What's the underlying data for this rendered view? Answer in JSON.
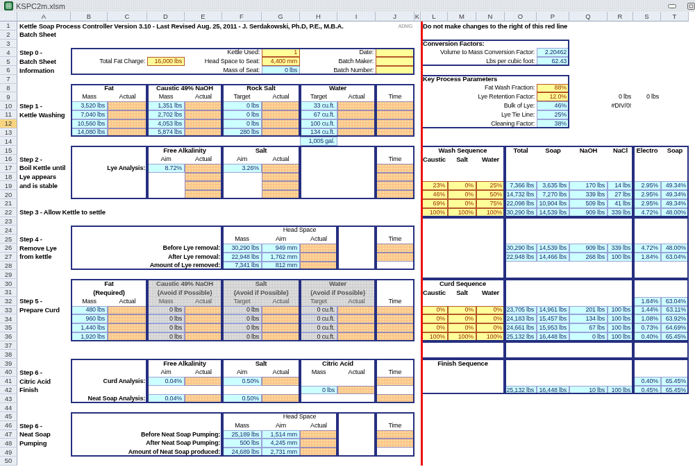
{
  "window": {
    "title": "KSPC2m.xlsm"
  },
  "columns": [
    "A",
    "B",
    "C",
    "D",
    "E",
    "F",
    "G",
    "H",
    "I",
    "J",
    "K",
    "L",
    "M",
    "N",
    "O",
    "P",
    "Q",
    "R",
    "S",
    "T"
  ],
  "rows": [
    {
      "number": "1",
      "selected": false,
      "cells": [
        {
          "kind": "title",
          "text": "Kettle Soap Process Controller Version 3.10 - Last Revised Aug. 25, 2011 - J. Serdakowski, Ph.D, P.E., M.B.A."
        },
        {
          "kind": "note",
          "text": "ADMG"
        },
        {
          "kind": "title",
          "text": "Do not make changes to the right of this red line"
        }
      ]
    },
    {
      "number": "2",
      "selected": false,
      "cells": [
        {
          "kind": "title",
          "text": "Batch Sheet"
        }
      ]
    },
    {
      "number": "3",
      "selected": false,
      "cells": [
        {
          "kind": "title",
          "text": "Conversion Factors:"
        }
      ]
    },
    {
      "number": "4",
      "selected": false,
      "cells": [
        {
          "kind": "step",
          "text": "Step 0 -"
        },
        {
          "kind": "label",
          "text": "Kettle Used:"
        },
        {
          "kind": "param",
          "text": "1"
        },
        {
          "kind": "label",
          "text": "Date:"
        },
        {
          "kind": "param"
        },
        {
          "kind": "label",
          "text": "Volume to Mass Conversion Factor:"
        },
        {
          "kind": "calc",
          "text": "2.20462"
        }
      ]
    },
    {
      "number": "5",
      "selected": false,
      "cells": [
        {
          "kind": "step",
          "text": "Batch Sheet"
        },
        {
          "kind": "label",
          "text": "Total Fat Charge:"
        },
        {
          "kind": "param",
          "text": "16,000 lbs"
        },
        {
          "kind": "label",
          "text": "Head Space to Seat:"
        },
        {
          "kind": "param",
          "text": "4,400 mm"
        },
        {
          "kind": "label",
          "text": "Batch Maker:"
        },
        {
          "kind": "param"
        },
        {
          "kind": "label",
          "text": "Lbs per cubic foot:"
        },
        {
          "kind": "calc",
          "text": "62.43"
        }
      ]
    },
    {
      "number": "6",
      "selected": false,
      "cells": [
        {
          "kind": "step",
          "text": "Information"
        },
        {
          "kind": "label",
          "text": "Mass of Seat:"
        },
        {
          "kind": "calc",
          "text": "0 lbs"
        },
        {
          "kind": "label",
          "text": "Batch Number:"
        },
        {
          "kind": "param"
        }
      ]
    },
    {
      "number": "7",
      "selected": false,
      "cells": [
        {
          "kind": "title",
          "text": "Key Process Parameters"
        }
      ]
    },
    {
      "number": "8",
      "selected": false,
      "cells": [
        {
          "kind": "heading",
          "text": "Fat"
        },
        {
          "kind": "heading",
          "text": "Caustic 49% NaOH"
        },
        {
          "kind": "heading",
          "text": "Rock Salt"
        },
        {
          "kind": "heading",
          "text": "Water"
        },
        {
          "kind": "label",
          "text": "Fat Wash Fraction:"
        },
        {
          "kind": "param",
          "text": "88%"
        }
      ]
    },
    {
      "number": "9",
      "selected": false,
      "cells": [
        {
          "kind": "subheading",
          "text": "Mass"
        },
        {
          "kind": "subheading",
          "text": "Actual"
        },
        {
          "kind": "subheading",
          "text": "Mass"
        },
        {
          "kind": "subheading",
          "text": "Actual"
        },
        {
          "kind": "subheading",
          "text": "Target"
        },
        {
          "kind": "subheading",
          "text": "Actual"
        },
        {
          "kind": "subheading",
          "text": "Target"
        },
        {
          "kind": "subheading",
          "text": "Actual"
        },
        {
          "kind": "subheading",
          "text": "Time"
        },
        {
          "kind": "label",
          "text": "Lye Retention Factor:"
        },
        {
          "kind": "param",
          "text": "12.0%"
        },
        {
          "kind": "value",
          "text": "0 lbs"
        },
        {
          "kind": "value",
          "text": "0 lbs"
        }
      ]
    },
    {
      "number": "10",
      "selected": false,
      "cells": [
        {
          "kind": "step",
          "text": "Step 1 -"
        },
        {
          "kind": "calc",
          "text": "3,520 lbs"
        },
        {
          "kind": "input"
        },
        {
          "kind": "calc",
          "text": "1,351 lbs"
        },
        {
          "kind": "input"
        },
        {
          "kind": "calc",
          "text": "0 lbs"
        },
        {
          "kind": "input"
        },
        {
          "kind": "calc",
          "text": "33 cu.ft."
        },
        {
          "kind": "input"
        },
        {
          "kind": "input"
        },
        {
          "kind": "label",
          "text": "Bulk of Lye:"
        },
        {
          "kind": "calc",
          "text": "46%"
        },
        {
          "kind": "value",
          "text": "#DIV/0!"
        }
      ]
    },
    {
      "number": "11",
      "selected": false,
      "cells": [
        {
          "kind": "step",
          "text": "Kettle Washing"
        },
        {
          "kind": "calc",
          "text": "7,040 lbs"
        },
        {
          "kind": "input"
        },
        {
          "kind": "calc",
          "text": "2,702 lbs"
        },
        {
          "kind": "input"
        },
        {
          "kind": "calc",
          "text": "0 lbs"
        },
        {
          "kind": "input"
        },
        {
          "kind": "calc",
          "text": "67 cu.ft."
        },
        {
          "kind": "input"
        },
        {
          "kind": "input"
        },
        {
          "kind": "label",
          "text": "Lye Tie Line:"
        },
        {
          "kind": "calc",
          "text": "25%"
        }
      ]
    },
    {
      "number": "12",
      "selected": true,
      "cells": [
        {
          "kind": "calc",
          "text": "10,560 lbs"
        },
        {
          "kind": "input"
        },
        {
          "kind": "calc",
          "text": "4,053 lbs"
        },
        {
          "kind": "input"
        },
        {
          "kind": "calc",
          "text": "0 lbs"
        },
        {
          "kind": "input"
        },
        {
          "kind": "calc",
          "text": "100 cu.ft."
        },
        {
          "kind": "input"
        },
        {
          "kind": "input"
        },
        {
          "kind": "label",
          "text": "Cleaning Factor:"
        },
        {
          "kind": "calc",
          "text": "38%"
        }
      ]
    },
    {
      "number": "13",
      "selected": false,
      "cells": [
        {
          "kind": "calc",
          "text": "14,080 lbs"
        },
        {
          "kind": "input"
        },
        {
          "kind": "calc",
          "text": "5,874 lbs"
        },
        {
          "kind": "input"
        },
        {
          "kind": "calc",
          "text": "280 lbs"
        },
        {
          "kind": "input"
        },
        {
          "kind": "calc",
          "text": "134 cu.ft."
        },
        {
          "kind": "input"
        },
        {
          "kind": "input"
        }
      ]
    },
    {
      "number": "14",
      "selected": false,
      "cells": [
        {
          "kind": "calc",
          "text": "1,005 gal."
        }
      ]
    },
    {
      "number": "15",
      "selected": false,
      "cells": [
        {
          "kind": "heading",
          "text": "Free Alkalinity"
        },
        {
          "kind": "heading",
          "text": "Salt"
        },
        {
          "kind": "heading",
          "text": "Wash Sequence"
        },
        {
          "kind": "heading",
          "text": "Total"
        },
        {
          "kind": "heading",
          "text": "Soap"
        },
        {
          "kind": "heading",
          "text": "NaOH"
        },
        {
          "kind": "heading",
          "text": "NaCl"
        },
        {
          "kind": "heading",
          "text": "Electro"
        },
        {
          "kind": "heading",
          "text": "Soap"
        }
      ]
    },
    {
      "number": "16",
      "selected": false,
      "cells": [
        {
          "kind": "step",
          "text": "Step 2 -"
        },
        {
          "kind": "subheading",
          "text": "Aim"
        },
        {
          "kind": "subheading",
          "text": "Actual"
        },
        {
          "kind": "subheading",
          "text": "Aim"
        },
        {
          "kind": "subheading",
          "text": "Actual"
        },
        {
          "kind": "subheading",
          "text": "Time"
        },
        {
          "kind": "heading",
          "text": "Caustic"
        },
        {
          "kind": "heading",
          "text": "Salt"
        },
        {
          "kind": "heading",
          "text": "Water"
        }
      ]
    },
    {
      "number": "17",
      "selected": false,
      "cells": [
        {
          "kind": "step",
          "text": "Boil Kettle until"
        },
        {
          "kind": "strong-label",
          "text": "Lye Analysis:"
        },
        {
          "kind": "calc",
          "text": "8.72%"
        },
        {
          "kind": "input"
        },
        {
          "kind": "calc",
          "text": "3.26%"
        },
        {
          "kind": "input"
        },
        {
          "kind": "input"
        }
      ]
    },
    {
      "number": "18",
      "selected": false,
      "cells": [
        {
          "kind": "step",
          "text": "Lye appears"
        },
        {
          "kind": "input"
        },
        {
          "kind": "input"
        },
        {
          "kind": "input"
        }
      ]
    },
    {
      "number": "19",
      "selected": false,
      "cells": [
        {
          "kind": "step",
          "text": "and is stable"
        },
        {
          "kind": "input"
        },
        {
          "kind": "input"
        },
        {
          "kind": "input"
        },
        {
          "kind": "param",
          "text": "23%"
        },
        {
          "kind": "param",
          "text": "0%"
        },
        {
          "kind": "param",
          "text": "25%"
        },
        {
          "kind": "calc",
          "text": "7,366 lbs"
        },
        {
          "kind": "calc",
          "text": "3,635 lbs"
        },
        {
          "kind": "calc",
          "text": "170 lbs"
        },
        {
          "kind": "calc",
          "text": "14 lbs"
        },
        {
          "kind": "calc",
          "text": "2.95%"
        },
        {
          "kind": "calc",
          "text": "49.34%"
        }
      ]
    },
    {
      "number": "20",
      "selected": false,
      "cells": [
        {
          "kind": "input"
        },
        {
          "kind": "input"
        },
        {
          "kind": "input"
        },
        {
          "kind": "param",
          "text": "46%"
        },
        {
          "kind": "param",
          "text": "0%"
        },
        {
          "kind": "param",
          "text": "50%"
        },
        {
          "kind": "calc",
          "text": "14,732 lbs"
        },
        {
          "kind": "calc",
          "text": "7,270 lbs"
        },
        {
          "kind": "calc",
          "text": "339 lbs"
        },
        {
          "kind": "calc",
          "text": "27 lbs"
        },
        {
          "kind": "calc",
          "text": "2.95%"
        },
        {
          "kind": "calc",
          "text": "49.34%"
        }
      ]
    },
    {
      "number": "21",
      "selected": false,
      "cells": [
        {
          "kind": "param",
          "text": "69%"
        },
        {
          "kind": "param",
          "text": "0%"
        },
        {
          "kind": "param",
          "text": "75%"
        },
        {
          "kind": "calc",
          "text": "22,098 lbs"
        },
        {
          "kind": "calc",
          "text": "10,904 lbs"
        },
        {
          "kind": "calc",
          "text": "509 lbs"
        },
        {
          "kind": "calc",
          "text": "41 lbs"
        },
        {
          "kind": "calc",
          "text": "2.95%"
        },
        {
          "kind": "calc",
          "text": "49.34%"
        }
      ]
    },
    {
      "number": "22",
      "selected": false,
      "cells": [
        {
          "kind": "step",
          "text": "Step 3 - Allow Kettle to settle"
        },
        {
          "kind": "param",
          "text": "100%"
        },
        {
          "kind": "param",
          "text": "100%"
        },
        {
          "kind": "param",
          "text": "100%"
        },
        {
          "kind": "calc",
          "text": "30,290 lbs"
        },
        {
          "kind": "calc",
          "text": "14,539 lbs"
        },
        {
          "kind": "calc",
          "text": "909 lbs"
        },
        {
          "kind": "calc",
          "text": "339 lbs"
        },
        {
          "kind": "calc",
          "text": "4.72%"
        },
        {
          "kind": "calc",
          "text": "48.00%"
        }
      ]
    },
    {
      "number": "23",
      "selected": false
    },
    {
      "number": "24",
      "selected": false,
      "cells": [
        {
          "kind": "subheading",
          "text": "Head Space"
        }
      ]
    },
    {
      "number": "25",
      "selected": false,
      "cells": [
        {
          "kind": "step",
          "text": "Step 4 -"
        },
        {
          "kind": "subheading",
          "text": "Mass"
        },
        {
          "kind": "subheading",
          "text": "Aim"
        },
        {
          "kind": "subheading",
          "text": "Actual"
        },
        {
          "kind": "subheading",
          "text": "Time"
        }
      ]
    },
    {
      "number": "26",
      "selected": false,
      "cells": [
        {
          "kind": "step",
          "text": "Remove Lye"
        },
        {
          "kind": "strong-label",
          "text": "Before Lye removal:"
        },
        {
          "kind": "calc",
          "text": "30,290 lbs"
        },
        {
          "kind": "calc",
          "text": "949 mm"
        },
        {
          "kind": "input"
        },
        {
          "kind": "input"
        },
        {
          "kind": "calc",
          "text": "30,290 lbs"
        },
        {
          "kind": "calc",
          "text": "14,539 lbs"
        },
        {
          "kind": "calc",
          "text": "909 lbs"
        },
        {
          "kind": "calc",
          "text": "339 lbs"
        },
        {
          "kind": "calc",
          "text": "4.72%"
        },
        {
          "kind": "calc",
          "text": "48.00%"
        }
      ]
    },
    {
      "number": "27",
      "selected": false,
      "cells": [
        {
          "kind": "step",
          "text": "from kettle"
        },
        {
          "kind": "strong-label",
          "text": "After Lye removal:"
        },
        {
          "kind": "calc",
          "text": "22,948 lbs"
        },
        {
          "kind": "calc",
          "text": "1,762 mm"
        },
        {
          "kind": "input"
        },
        {
          "kind": "input"
        },
        {
          "kind": "calc",
          "text": "22,948 lbs"
        },
        {
          "kind": "calc",
          "text": "14,466 lbs"
        },
        {
          "kind": "calc",
          "text": "268 lbs"
        },
        {
          "kind": "calc",
          "text": "100 lbs"
        },
        {
          "kind": "calc",
          "text": "1.84%"
        },
        {
          "kind": "calc",
          "text": "63.04%"
        }
      ]
    },
    {
      "number": "28",
      "selected": false,
      "cells": [
        {
          "kind": "strong-label",
          "text": "Amount of Lye removed:"
        },
        {
          "kind": "calc",
          "text": "7,341 lbs"
        },
        {
          "kind": "calc",
          "text": "812 mm"
        },
        {
          "kind": "input"
        }
      ]
    },
    {
      "number": "29",
      "selected": false
    },
    {
      "number": "30",
      "selected": false,
      "cells": [
        {
          "kind": "heading",
          "text": "Fat"
        },
        {
          "kind": "off-heading",
          "text": "Caustic 49% NaOH"
        },
        {
          "kind": "off-heading",
          "text": "Salt"
        },
        {
          "kind": "off-heading",
          "text": "Water"
        },
        {
          "kind": "heading",
          "text": "Curd Sequence"
        }
      ]
    },
    {
      "number": "31",
      "selected": false,
      "cells": [
        {
          "kind": "heading",
          "text": "(Required)"
        },
        {
          "kind": "off-heading",
          "text": "(Avoid if Possible)"
        },
        {
          "kind": "off-heading",
          "text": "(Avoid if Possible)"
        },
        {
          "kind": "off-heading",
          "text": "(Avoid if Possible)"
        },
        {
          "kind": "heading",
          "text": "Caustic"
        },
        {
          "kind": "heading",
          "text": "Salt"
        },
        {
          "kind": "heading",
          "text": "Water"
        }
      ]
    },
    {
      "number": "32",
      "selected": false,
      "cells": [
        {
          "kind": "step",
          "text": "Step 5 -"
        },
        {
          "kind": "subheading",
          "text": "Mass"
        },
        {
          "kind": "subheading",
          "text": "Actual"
        },
        {
          "kind": "off-subheading",
          "text": "Mass"
        },
        {
          "kind": "off-subheading",
          "text": "Actual"
        },
        {
          "kind": "off-subheading",
          "text": "Target"
        },
        {
          "kind": "off-subheading",
          "text": "Actual"
        },
        {
          "kind": "off-subheading",
          "text": "Target"
        },
        {
          "kind": "off-subheading",
          "text": "Actual"
        },
        {
          "kind": "subheading",
          "text": "Time"
        },
        {
          "kind": "calc",
          "text": "1.84%"
        },
        {
          "kind": "calc",
          "text": "63.04%"
        }
      ]
    },
    {
      "number": "33",
      "selected": false,
      "cells": [
        {
          "kind": "step",
          "text": "Prepare Curd"
        },
        {
          "kind": "calc",
          "text": "480 lbs"
        },
        {
          "kind": "input"
        },
        {
          "kind": "off-calc",
          "text": "0 lbs"
        },
        {
          "kind": "input"
        },
        {
          "kind": "off-calc",
          "text": "0 lbs"
        },
        {
          "kind": "input"
        },
        {
          "kind": "off-calc",
          "text": "0 cu.ft."
        },
        {
          "kind": "input"
        },
        {
          "kind": "input"
        },
        {
          "kind": "param",
          "text": "0%"
        },
        {
          "kind": "param",
          "text": "0%"
        },
        {
          "kind": "param",
          "text": "0%"
        },
        {
          "kind": "calc",
          "text": "23,705 lbs"
        },
        {
          "kind": "calc",
          "text": "14,961 lbs"
        },
        {
          "kind": "calc",
          "text": "201 lbs"
        },
        {
          "kind": "calc",
          "text": "100 lbs"
        },
        {
          "kind": "calc",
          "text": "1.44%"
        },
        {
          "kind": "calc",
          "text": "63.11%"
        }
      ]
    },
    {
      "number": "34",
      "selected": false,
      "cells": [
        {
          "kind": "calc",
          "text": "960 lbs"
        },
        {
          "kind": "input"
        },
        {
          "kind": "off-calc",
          "text": "0 lbs"
        },
        {
          "kind": "input"
        },
        {
          "kind": "off-calc",
          "text": "0 lbs"
        },
        {
          "kind": "input"
        },
        {
          "kind": "off-calc",
          "text": "0 cu.ft."
        },
        {
          "kind": "input"
        },
        {
          "kind": "input"
        },
        {
          "kind": "param",
          "text": "0%"
        },
        {
          "kind": "param",
          "text": "0%"
        },
        {
          "kind": "param",
          "text": "0%"
        },
        {
          "kind": "calc",
          "text": "24,183 lbs"
        },
        {
          "kind": "calc",
          "text": "15,457 lbs"
        },
        {
          "kind": "calc",
          "text": "134 lbs"
        },
        {
          "kind": "calc",
          "text": "100 lbs"
        },
        {
          "kind": "calc",
          "text": "1.08%"
        },
        {
          "kind": "calc",
          "text": "63.92%"
        }
      ]
    },
    {
      "number": "35",
      "selected": false,
      "cells": [
        {
          "kind": "calc",
          "text": "1,440 lbs"
        },
        {
          "kind": "input"
        },
        {
          "kind": "off-calc",
          "text": "0 lbs"
        },
        {
          "kind": "input"
        },
        {
          "kind": "off-calc",
          "text": "0 lbs"
        },
        {
          "kind": "input"
        },
        {
          "kind": "off-calc",
          "text": "0 cu.ft."
        },
        {
          "kind": "input"
        },
        {
          "kind": "input"
        },
        {
          "kind": "param",
          "text": "0%"
        },
        {
          "kind": "param",
          "text": "0%"
        },
        {
          "kind": "param",
          "text": "0%"
        },
        {
          "kind": "calc",
          "text": "24,661 lbs"
        },
        {
          "kind": "calc",
          "text": "15,953 lbs"
        },
        {
          "kind": "calc",
          "text": "67 lbs"
        },
        {
          "kind": "calc",
          "text": "100 lbs"
        },
        {
          "kind": "calc",
          "text": "0.73%"
        },
        {
          "kind": "calc",
          "text": "64.69%"
        }
      ]
    },
    {
      "number": "36",
      "selected": false,
      "cells": [
        {
          "kind": "calc",
          "text": "1,920 lbs"
        },
        {
          "kind": "input"
        },
        {
          "kind": "off-calc",
          "text": "0 lbs"
        },
        {
          "kind": "input"
        },
        {
          "kind": "off-calc",
          "text": "0 lbs"
        },
        {
          "kind": "input"
        },
        {
          "kind": "off-calc",
          "text": "0 cu.ft."
        },
        {
          "kind": "input"
        },
        {
          "kind": "input"
        },
        {
          "kind": "param",
          "text": "100%"
        },
        {
          "kind": "param",
          "text": "100%"
        },
        {
          "kind": "param",
          "text": "100%"
        },
        {
          "kind": "calc",
          "text": "25,132 lbs"
        },
        {
          "kind": "calc",
          "text": "16,448 lbs"
        },
        {
          "kind": "calc",
          "text": "0 lbs"
        },
        {
          "kind": "calc",
          "text": "100 lbs"
        },
        {
          "kind": "calc",
          "text": "0.40%"
        },
        {
          "kind": "calc",
          "text": "65.45%"
        }
      ]
    },
    {
      "number": "37",
      "selected": false
    },
    {
      "number": "38",
      "selected": false
    },
    {
      "number": "39",
      "selected": false,
      "cells": [
        {
          "kind": "heading",
          "text": "Free Alkalinity"
        },
        {
          "kind": "heading",
          "text": "Salt"
        },
        {
          "kind": "heading",
          "text": "Citric Acid"
        },
        {
          "kind": "heading",
          "text": "Finish Sequence"
        }
      ]
    },
    {
      "number": "40",
      "selected": false,
      "cells": [
        {
          "kind": "step",
          "text": "Step 6 -"
        },
        {
          "kind": "subheading",
          "text": "Aim"
        },
        {
          "kind": "subheading",
          "text": "Actual"
        },
        {
          "kind": "subheading",
          "text": "Aim"
        },
        {
          "kind": "subheading",
          "text": "Actual"
        },
        {
          "kind": "subheading",
          "text": "Mass"
        },
        {
          "kind": "subheading",
          "text": "Actual"
        },
        {
          "kind": "subheading",
          "text": "Time"
        }
      ]
    },
    {
      "number": "41",
      "selected": false,
      "cells": [
        {
          "kind": "step",
          "text": "Citric Acid"
        },
        {
          "kind": "strong-label",
          "text": "Curd Analysis:"
        },
        {
          "kind": "calc",
          "text": "0.04%"
        },
        {
          "kind": "input"
        },
        {
          "kind": "calc",
          "text": "0.50%"
        },
        {
          "kind": "input"
        },
        {
          "kind": "input"
        },
        {
          "kind": "calc",
          "text": "0.40%"
        },
        {
          "kind": "calc",
          "text": "65.45%"
        }
      ]
    },
    {
      "number": "42",
      "selected": false,
      "cells": [
        {
          "kind": "step",
          "text": "Finish"
        },
        {
          "kind": "calc",
          "text": "0 lbs"
        },
        {
          "kind": "input"
        },
        {
          "kind": "calc",
          "text": "25,132 lbs"
        },
        {
          "kind": "calc",
          "text": "16,448 lbs"
        },
        {
          "kind": "calc",
          "text": "10 lbs"
        },
        {
          "kind": "calc",
          "text": "100 lbs"
        },
        {
          "kind": "calc",
          "text": "0.45%"
        },
        {
          "kind": "calc",
          "text": "65.45%"
        }
      ]
    },
    {
      "number": "43",
      "selected": false,
      "cells": [
        {
          "kind": "strong-label",
          "text": "Neat Soap Analysis:"
        },
        {
          "kind": "calc",
          "text": "0.04%"
        },
        {
          "kind": "input"
        },
        {
          "kind": "calc",
          "text": "0.50%"
        },
        {
          "kind": "input"
        },
        {
          "kind": "input"
        }
      ]
    },
    {
      "number": "44",
      "selected": false
    },
    {
      "number": "45",
      "selected": false,
      "cells": [
        {
          "kind": "subheading",
          "text": "Head Space"
        }
      ]
    },
    {
      "number": "46",
      "selected": false,
      "cells": [
        {
          "kind": "step",
          "text": "Step 6 -"
        },
        {
          "kind": "subheading",
          "text": "Mass"
        },
        {
          "kind": "subheading",
          "text": "Aim"
        },
        {
          "kind": "subheading",
          "text": "Actual"
        },
        {
          "kind": "subheading",
          "text": "Time"
        }
      ]
    },
    {
      "number": "47",
      "selected": false,
      "cells": [
        {
          "kind": "step",
          "text": "Neat Soap"
        },
        {
          "kind": "strong-label",
          "text": "Before Neat Soap Pumping:"
        },
        {
          "kind": "calc",
          "text": "25,189 lbs"
        },
        {
          "kind": "calc",
          "text": "1,514 mm"
        },
        {
          "kind": "input"
        },
        {
          "kind": "input"
        }
      ]
    },
    {
      "number": "48",
      "selected": false,
      "cells": [
        {
          "kind": "step",
          "text": "Pumping"
        },
        {
          "kind": "strong-label",
          "text": "After Neat Soap Pumping:"
        },
        {
          "kind": "calc",
          "text": "500 lbs"
        },
        {
          "kind": "calc",
          "text": "4,245 mm"
        },
        {
          "kind": "input"
        },
        {
          "kind": "input"
        }
      ]
    },
    {
      "number": "49",
      "selected": false,
      "cells": [
        {
          "kind": "strong-label",
          "text": "Amount of Neat Soap produced:"
        },
        {
          "kind": "calc",
          "text": "24,689 lbs"
        },
        {
          "kind": "calc",
          "text": "2,731 mm"
        },
        {
          "kind": "input"
        }
      ]
    },
    {
      "number": "50",
      "selected": false
    }
  ]
}
